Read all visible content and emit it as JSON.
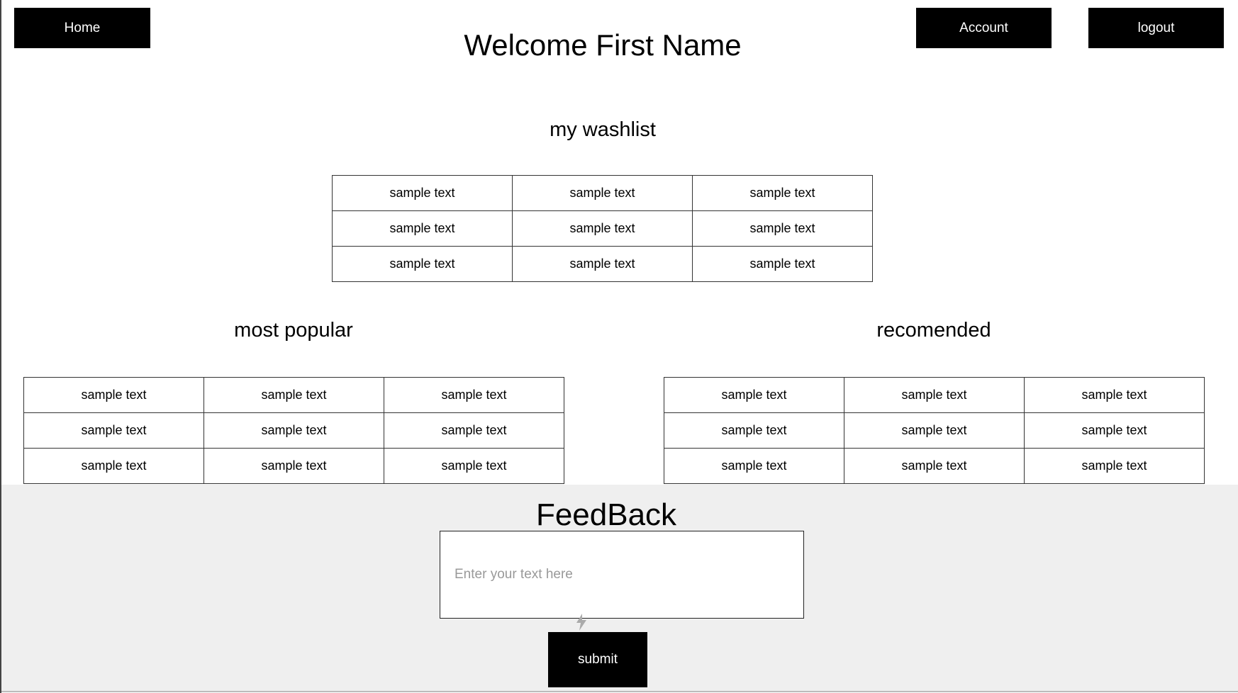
{
  "nav": {
    "home": "Home",
    "account": "Account",
    "logout": "logout"
  },
  "title": "Welcome First Name",
  "washlist": {
    "heading": "my washlist",
    "rows": [
      [
        "sample text",
        "sample text",
        "sample text"
      ],
      [
        "sample text",
        "sample text",
        "sample text"
      ],
      [
        "sample text",
        "sample text",
        "sample text"
      ]
    ]
  },
  "popular": {
    "heading": "most popular",
    "rows": [
      [
        "sample text",
        "sample text",
        "sample text"
      ],
      [
        "sample text",
        "sample text",
        "sample text"
      ],
      [
        "sample text",
        "sample text",
        "sample text"
      ]
    ]
  },
  "recommended": {
    "heading": "recomended",
    "rows": [
      [
        "sample text",
        "sample text",
        "sample text"
      ],
      [
        "sample text",
        "sample text",
        "sample text"
      ],
      [
        "sample text",
        "sample text",
        "sample text"
      ]
    ]
  },
  "feedback": {
    "heading": "FeedBack",
    "placeholder": "Enter your text here",
    "value": "",
    "submit": "submit"
  }
}
